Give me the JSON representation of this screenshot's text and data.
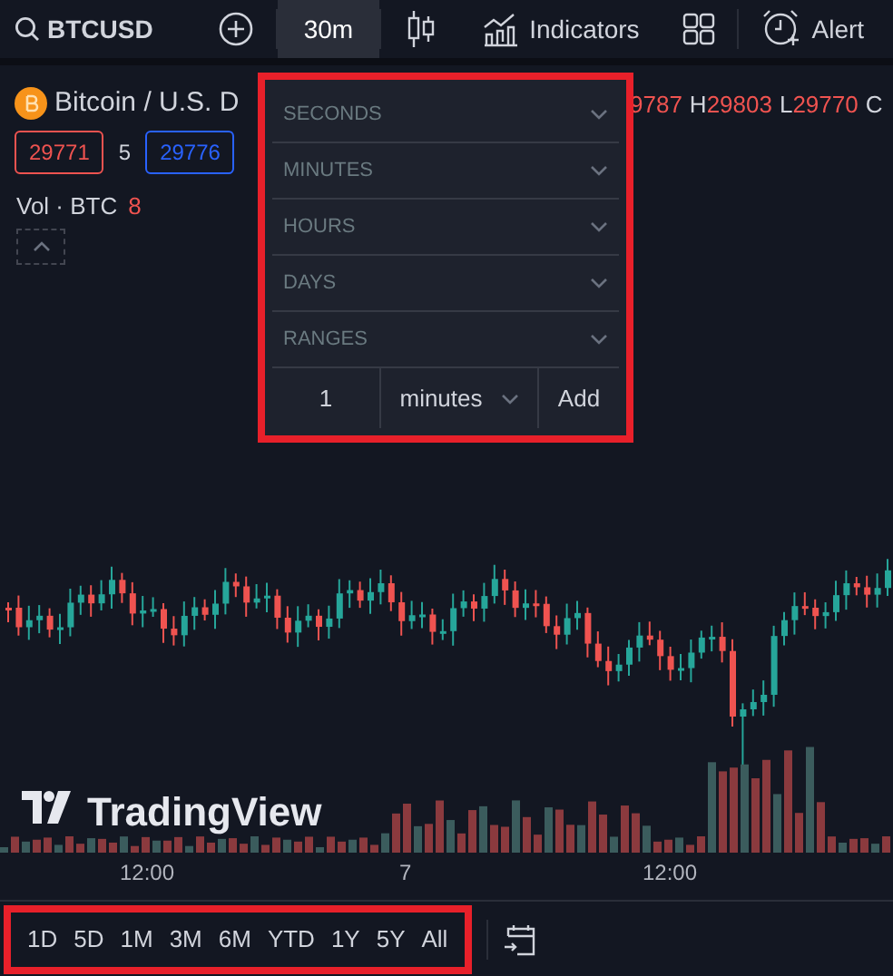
{
  "toolbar": {
    "symbol": "BTCUSD",
    "items": [
      {
        "kind": "add"
      },
      {
        "kind": "interval",
        "label": "30m",
        "selected": true
      },
      {
        "kind": "chart-type"
      },
      {
        "kind": "indicators",
        "label": "Indicators"
      },
      {
        "kind": "layouts"
      },
      {
        "kind": "alert",
        "label": "Alert"
      }
    ]
  },
  "legend": {
    "title": "Bitcoin / U.S. D",
    "ohlc": [
      {
        "text": "9787",
        "kind": "value"
      },
      {
        "text": "H",
        "kind": "key"
      },
      {
        "text": "29803",
        "kind": "value"
      },
      {
        "text": "L",
        "kind": "key"
      },
      {
        "text": "29770",
        "kind": "value"
      },
      {
        "text": "C",
        "kind": "key"
      }
    ],
    "sell": "29771",
    "spread": "5",
    "buy": "29776",
    "volume_label": "Vol · BTC",
    "volume_value": "8",
    "collapsed": false
  },
  "interval_menu": {
    "highlighted": true,
    "sections": [
      {
        "label": "SECONDS",
        "expanded": false
      },
      {
        "label": "MINUTES",
        "expanded": false
      },
      {
        "label": "HOURS",
        "expanded": false
      },
      {
        "label": "DAYS",
        "expanded": false
      },
      {
        "label": "RANGES",
        "expanded": false
      }
    ],
    "custom": {
      "value": "1",
      "unit": "minutes",
      "button": "Add"
    }
  },
  "watermark": "TradingView",
  "time_axis": [
    "12:00",
    "7",
    "12:00"
  ],
  "range_bar": {
    "highlighted": true,
    "ranges": [
      "1D",
      "5D",
      "1M",
      "3M",
      "6M",
      "YTD",
      "1Y",
      "5Y",
      "All"
    ]
  }
}
